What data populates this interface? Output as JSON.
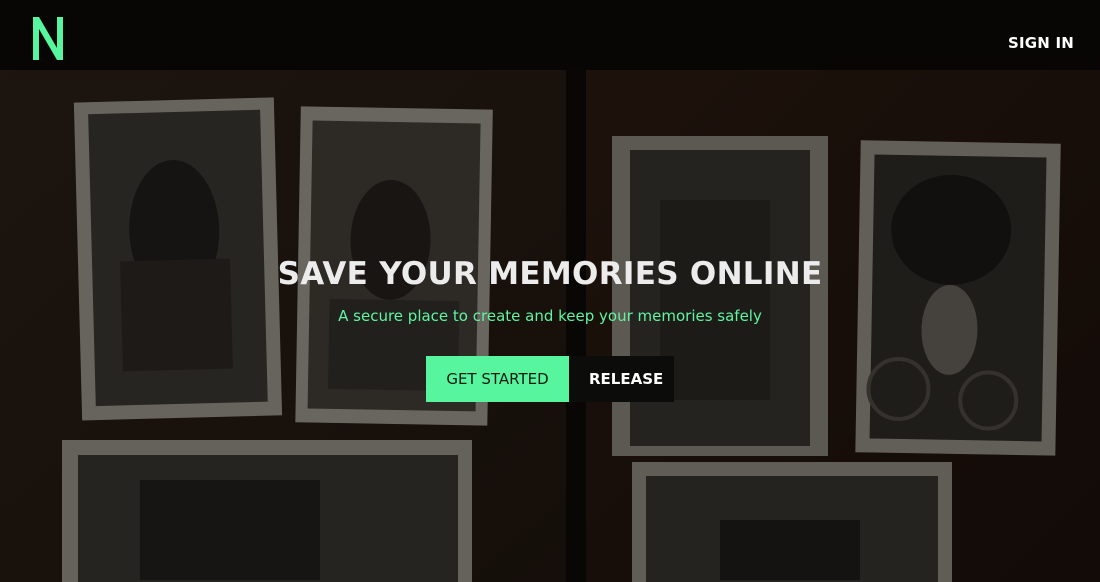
{
  "header": {
    "logo_letter": "N",
    "sign_in_label": "SIGN IN"
  },
  "hero": {
    "headline": "SAVE YOUR MEMORIES ONLINE",
    "tagline": "A secure place to create and keep your memories safely",
    "primary_button_label": "GET STARTED",
    "secondary_button_label": "RELEASE"
  },
  "colors": {
    "accent": "#56f59e",
    "tagline": "#5ff5a1",
    "headline": "#ececec",
    "background": "#0b0a09"
  },
  "icons": {
    "logo": "letter-n-logo"
  }
}
